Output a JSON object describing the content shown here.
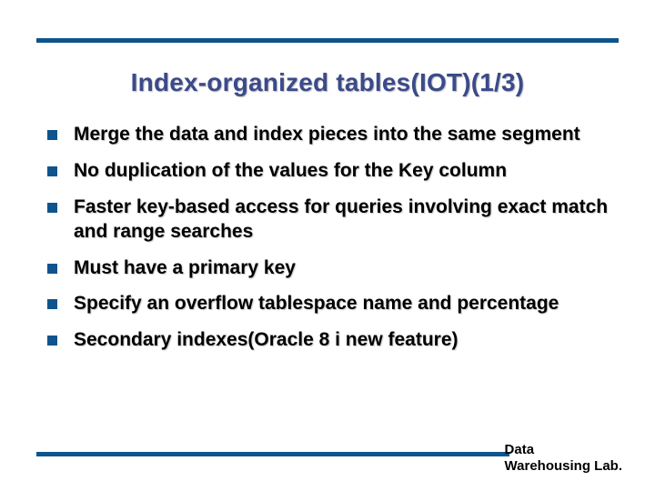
{
  "title": "Index-organized tables(IOT)(1/3)",
  "bullets": [
    "Merge the data and index pieces into the same segment",
    "No duplication of the values for the Key column",
    "Faster key-based access for queries involving exact match and range searches",
    "Must have a primary key",
    "Specify an overflow tablespace name and percentage",
    "Secondary indexes(Oracle 8 i new feature)"
  ],
  "footer_line1": "Data",
  "footer_line2": "Warehousing Lab."
}
